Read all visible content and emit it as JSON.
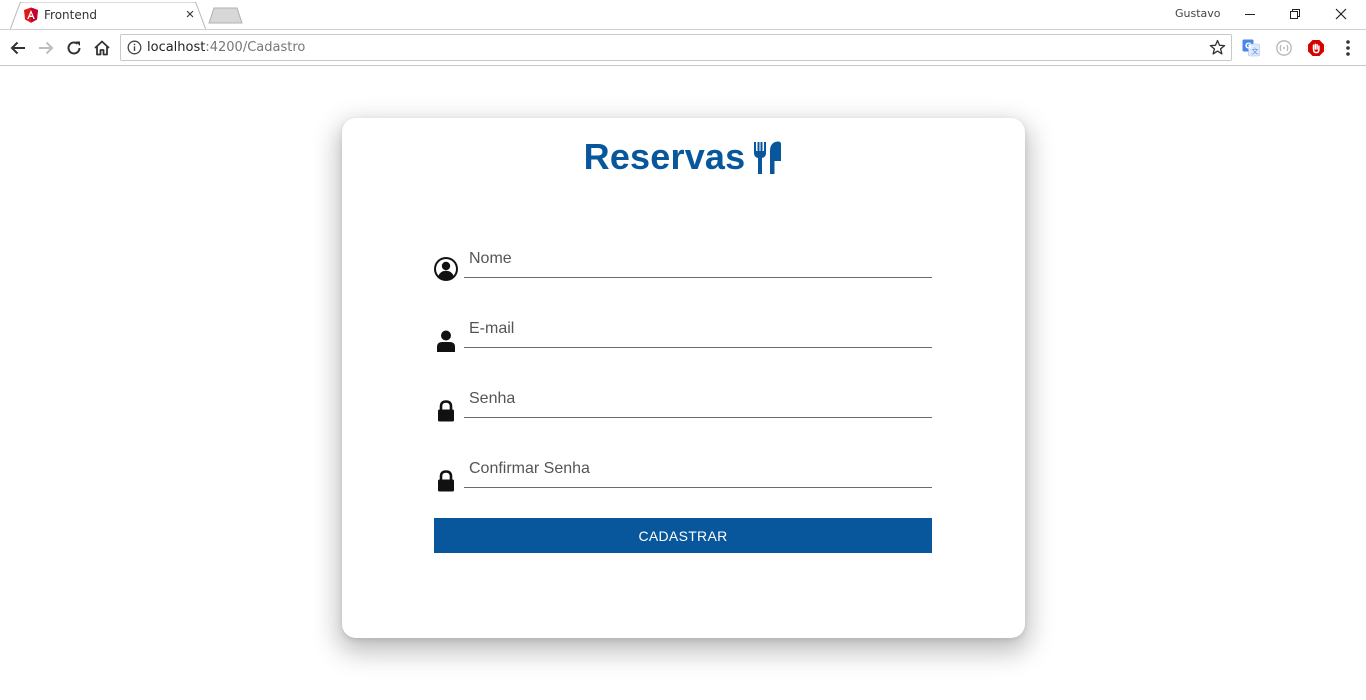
{
  "browser": {
    "tab_title": "Frontend",
    "tab_close": "×",
    "profile_name": "Gustavo",
    "url_host": "localhost",
    "url_path": ":4200/Cadastro",
    "icons": {
      "favicon": "angular-icon",
      "back": "back-arrow-icon",
      "forward": "forward-arrow-icon",
      "reload": "reload-icon",
      "home": "home-icon",
      "info": "info-icon",
      "bookmark": "star-icon",
      "ext1": "translate-icon",
      "ext2": "extension-icon",
      "ext3": "adblock-icon",
      "menu": "menu-dots-icon"
    }
  },
  "page": {
    "title": "Reservas",
    "title_icon": "utensils-icon",
    "fields": [
      {
        "placeholder": "Nome",
        "icon": "user-circle-icon",
        "value": ""
      },
      {
        "placeholder": "E-mail",
        "icon": "user-icon",
        "value": ""
      },
      {
        "placeholder": "Senha",
        "icon": "lock-icon",
        "value": ""
      },
      {
        "placeholder": "Confirmar Senha",
        "icon": "lock-icon",
        "value": ""
      }
    ],
    "submit_label": "CADASTRAR"
  },
  "colors": {
    "brand": "#08579c",
    "button_text": "#ffffff",
    "icon": "#111111"
  }
}
